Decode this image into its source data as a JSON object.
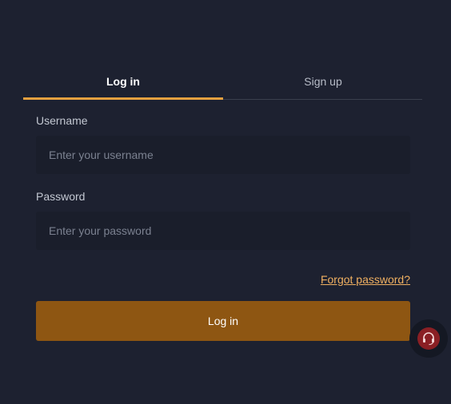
{
  "tabs": {
    "login_label": "Log in",
    "signup_label": "Sign up",
    "active": "login"
  },
  "form": {
    "username_label": "Username",
    "username_placeholder": "Enter your username",
    "username_value": "",
    "password_label": "Password",
    "password_placeholder": "Enter your password",
    "password_value": "",
    "forgot_label": "Forgot password?",
    "submit_label": "Log in"
  },
  "support": {
    "icon": "headset-support-icon"
  },
  "colors": {
    "background": "#1d2130",
    "input_background": "#1a1e2b",
    "accent": "#e4a03f",
    "link": "#f0b061",
    "button": "#8e5612",
    "support_badge": "#8a1f24"
  }
}
